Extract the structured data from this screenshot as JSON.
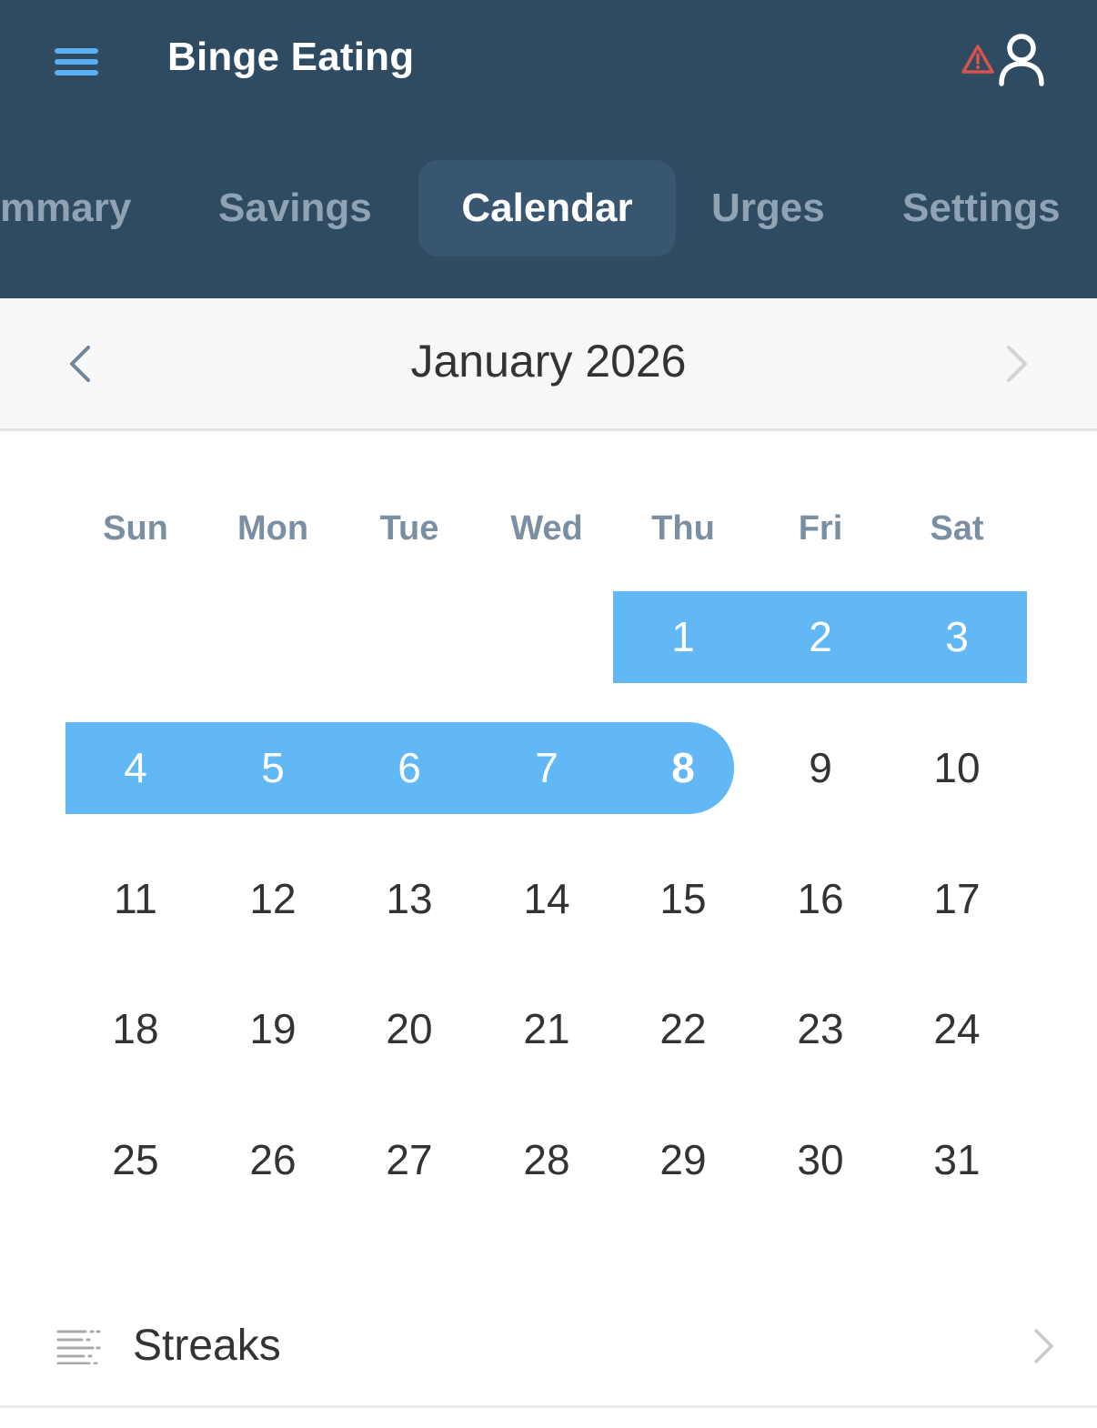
{
  "header": {
    "title": "Binge Eating"
  },
  "tabs": [
    {
      "label": "Summary",
      "visible_text": "mmary",
      "active": false
    },
    {
      "label": "Savings",
      "active": false
    },
    {
      "label": "Calendar",
      "active": true
    },
    {
      "label": "Urges",
      "active": false
    },
    {
      "label": "Settings",
      "active": false
    }
  ],
  "calendar": {
    "month_label": "January 2026",
    "weekdays": [
      "Sun",
      "Mon",
      "Tue",
      "Wed",
      "Thu",
      "Fri",
      "Sat"
    ],
    "highlighted_days": [
      1,
      2,
      3,
      4,
      5,
      6,
      7,
      8
    ],
    "today": 8,
    "weeks": [
      [
        "",
        "",
        "",
        "",
        "1",
        "2",
        "3"
      ],
      [
        "4",
        "5",
        "6",
        "7",
        "8",
        "9",
        "10"
      ],
      [
        "11",
        "12",
        "13",
        "14",
        "15",
        "16",
        "17"
      ],
      [
        "18",
        "19",
        "20",
        "21",
        "22",
        "23",
        "24"
      ],
      [
        "25",
        "26",
        "27",
        "28",
        "29",
        "30",
        "31"
      ]
    ]
  },
  "streaks": {
    "label": "Streaks"
  },
  "icons": {
    "menu": "hamburger-menu-icon",
    "alert": "warning-triangle-icon",
    "user": "user-profile-icon",
    "prev": "chevron-left-icon",
    "next": "chevron-right-icon",
    "streaks": "list-lines-icon",
    "row_chevron": "chevron-right-icon"
  },
  "colors": {
    "header_bg": "#2e4b62",
    "active_tab_bg": "#385670",
    "inactive_tab_text": "#8fa3b4",
    "accent_blue": "#5aaef2",
    "highlight_blue": "#62b8f5",
    "alert_red": "#d9534f",
    "weekday_text": "#7b8fa2"
  }
}
